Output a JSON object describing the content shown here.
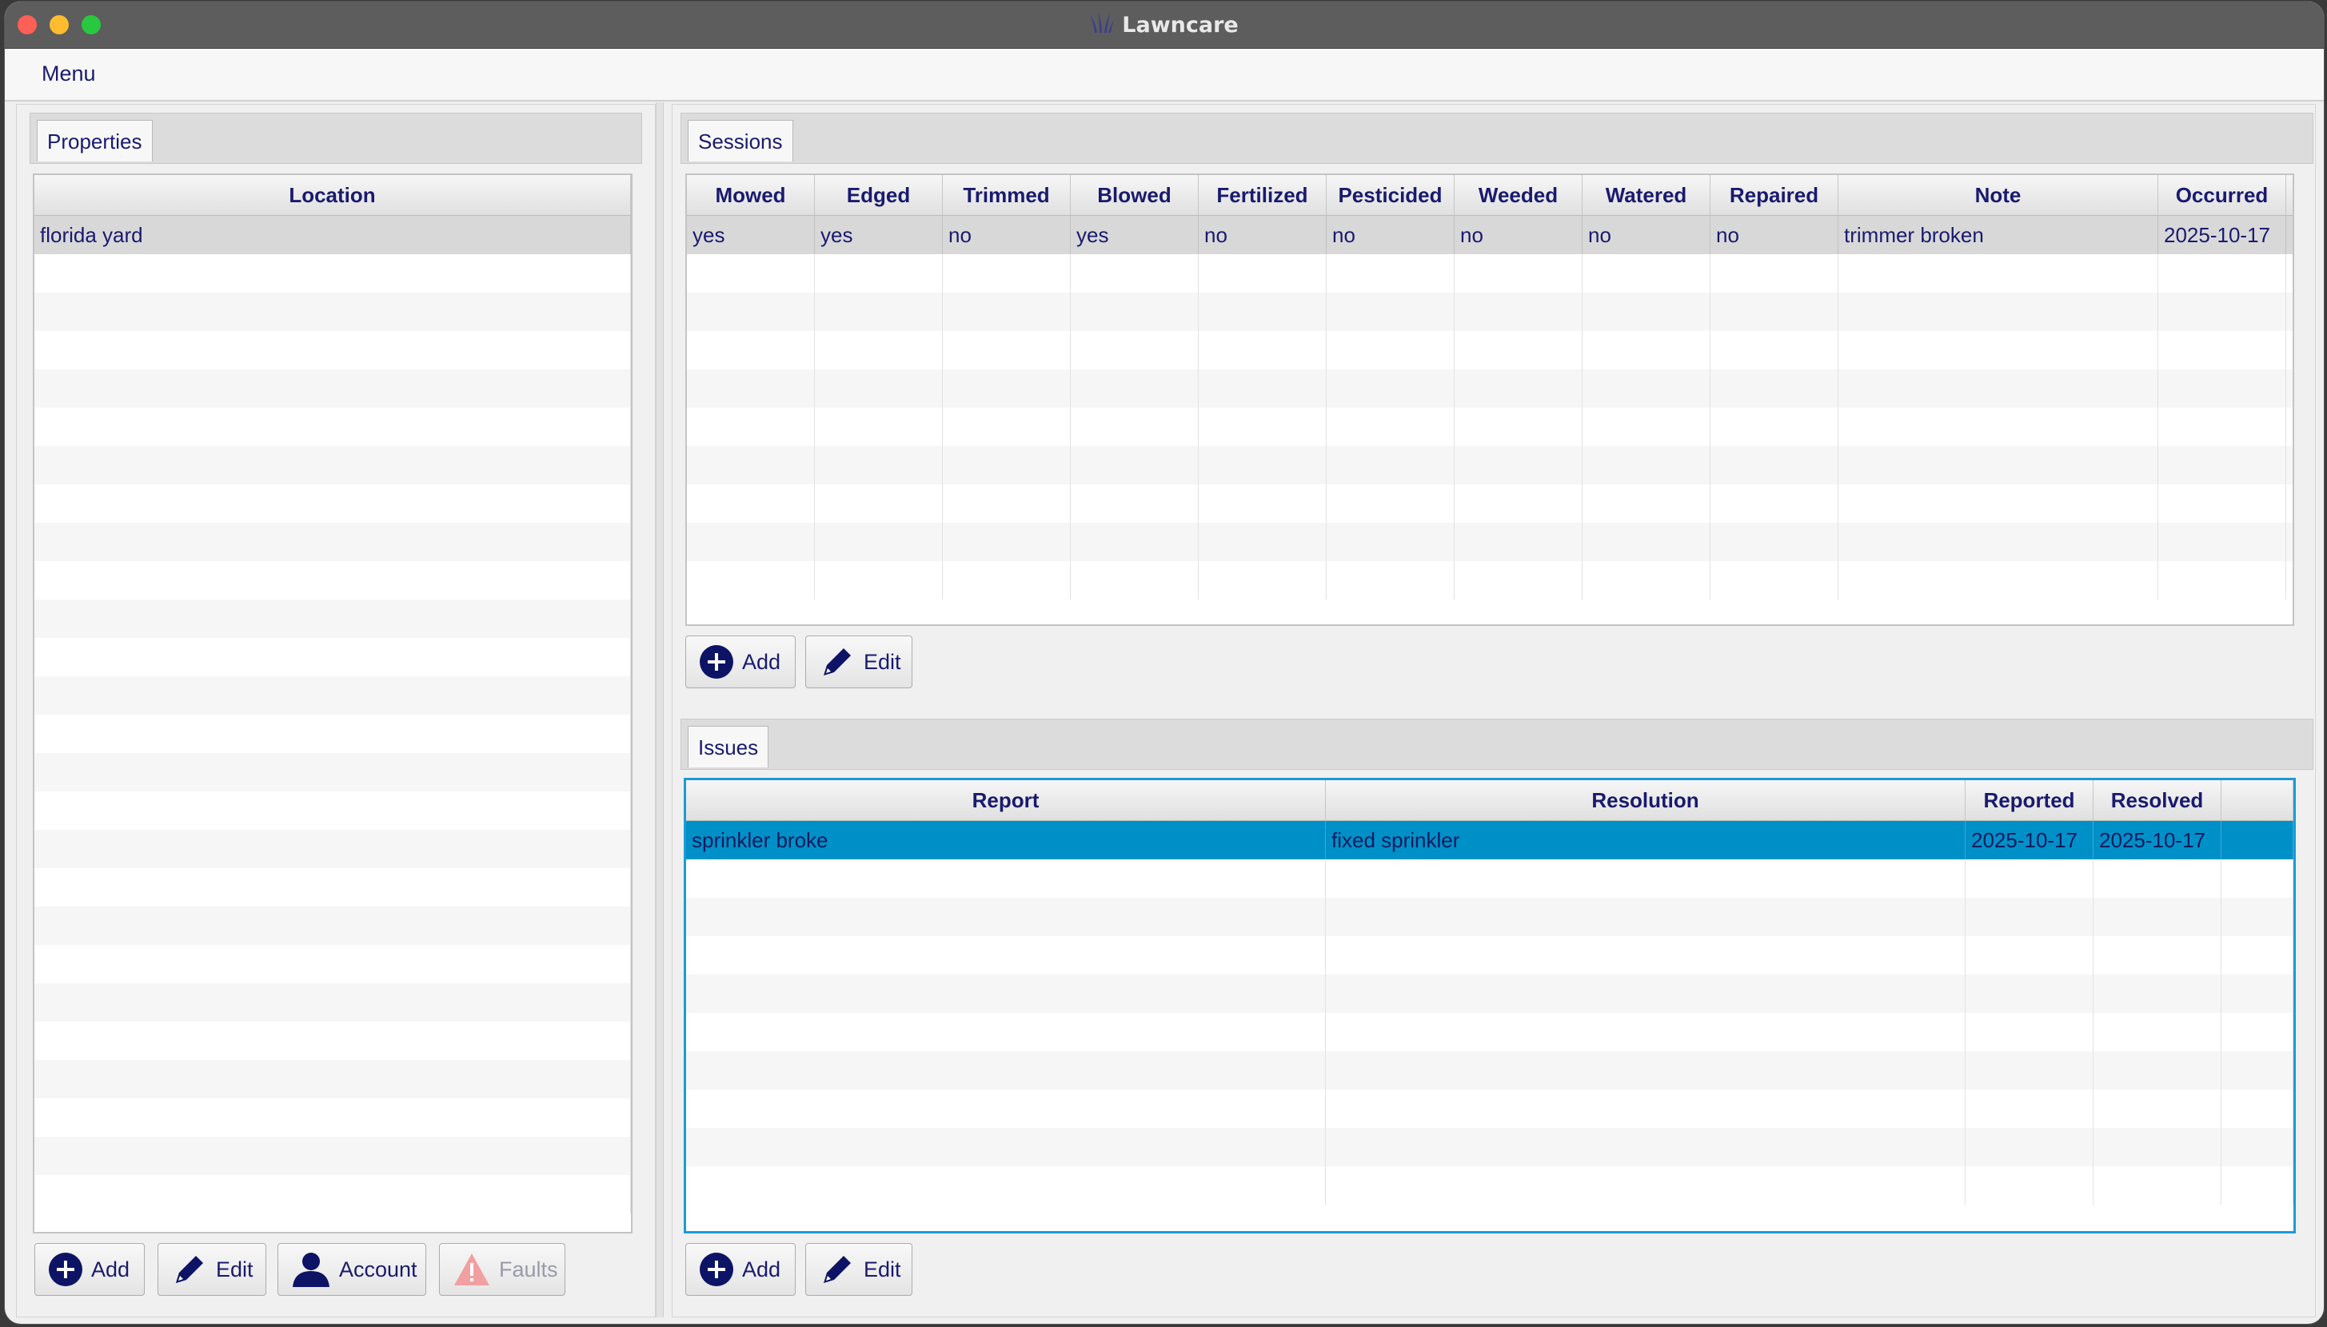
{
  "window": {
    "title": "Lawncare"
  },
  "menubar": {
    "menu_label": "Menu"
  },
  "properties": {
    "tab_label": "Properties",
    "columns": [
      "Location"
    ],
    "rows": [
      [
        "florida yard"
      ]
    ],
    "buttons": {
      "add": "Add",
      "edit": "Edit",
      "account": "Account",
      "faults": "Faults"
    }
  },
  "sessions": {
    "tab_label": "Sessions",
    "columns": [
      "Mowed",
      "Edged",
      "Trimmed",
      "Blowed",
      "Fertilized",
      "Pesticided",
      "Weeded",
      "Watered",
      "Repaired",
      "Note",
      "Occurred"
    ],
    "rows": [
      [
        "yes",
        "yes",
        "no",
        "yes",
        "no",
        "no",
        "no",
        "no",
        "no",
        "trimmer broken",
        "2025-10-17"
      ]
    ],
    "buttons": {
      "add": "Add",
      "edit": "Edit"
    }
  },
  "issues": {
    "tab_label": "Issues",
    "columns": [
      "Report",
      "Resolution",
      "Reported",
      "Resolved",
      ""
    ],
    "rows": [
      [
        "sprinkler broke",
        "fixed sprinkler",
        "2025-10-17",
        "2025-10-17",
        ""
      ]
    ],
    "buttons": {
      "add": "Add",
      "edit": "Edit"
    }
  },
  "colors": {
    "text": "#1a1a6e",
    "selection_blue": "#0090c8",
    "focus_border": "#1b9bd6",
    "icon_navy": "#0d1466",
    "warning_icon": "#f0a0a0"
  },
  "icons": {
    "add": "plus-circle-icon",
    "edit": "pencil-icon",
    "account": "user-icon",
    "faults": "warning-icon",
    "app": "grass-icon"
  }
}
